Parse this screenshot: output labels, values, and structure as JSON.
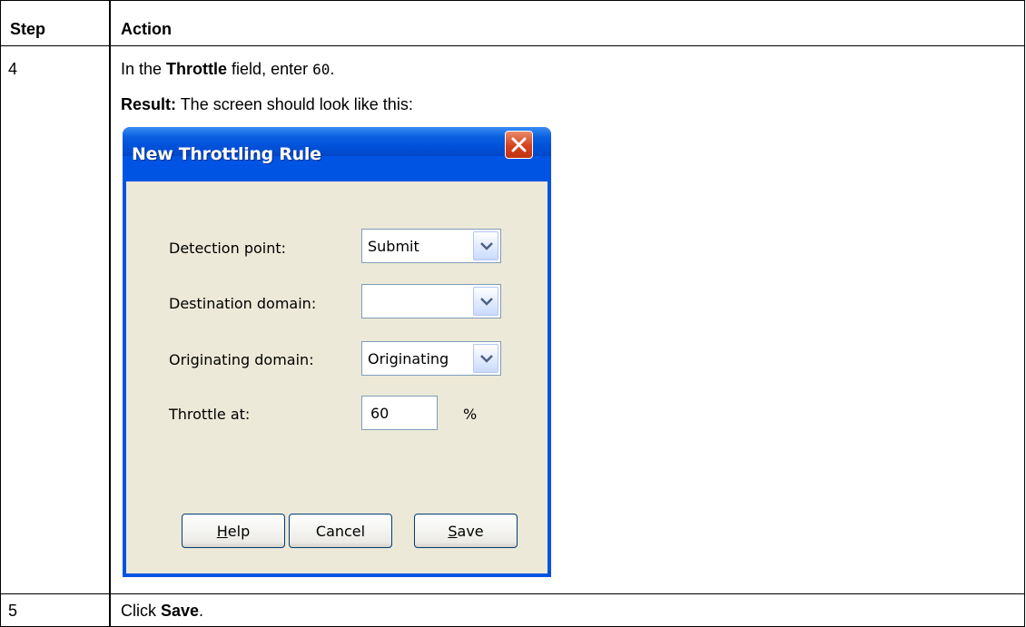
{
  "table": {
    "headers": {
      "step": "Step",
      "action": "Action"
    },
    "rows": [
      {
        "step": "4",
        "instruction": {
          "prefix": "In the ",
          "field": "Throttle",
          "middle": " field, enter ",
          "value": "60",
          "suffix": "."
        },
        "result": {
          "label": "Result:",
          "text": " The screen should look like this:"
        }
      },
      {
        "step": "5",
        "instruction": {
          "prefix": "Click ",
          "target": "Save",
          "suffix": "."
        }
      }
    ]
  },
  "dialog": {
    "title": "New Throttling Rule",
    "fields": {
      "detection_point": {
        "label": "Detection point:",
        "value": "Submit"
      },
      "destination_domain": {
        "label": "Destination domain:",
        "value": ""
      },
      "originating_domain": {
        "label": "Originating domain:",
        "value": "Originating"
      },
      "throttle_at": {
        "label": "Throttle at:",
        "value": "60",
        "unit": "%"
      }
    },
    "buttons": {
      "help": {
        "accel": "H",
        "rest": "elp"
      },
      "cancel": {
        "label": "Cancel"
      },
      "save": {
        "accel": "S",
        "rest": "ave"
      }
    }
  },
  "icons": {
    "close": "close-x-icon",
    "dropdown": "chevron-down-icon"
  },
  "colors": {
    "titlebar": "#0054e3",
    "dialog_face": "#ece9d8",
    "close_button": "#d5421c"
  }
}
